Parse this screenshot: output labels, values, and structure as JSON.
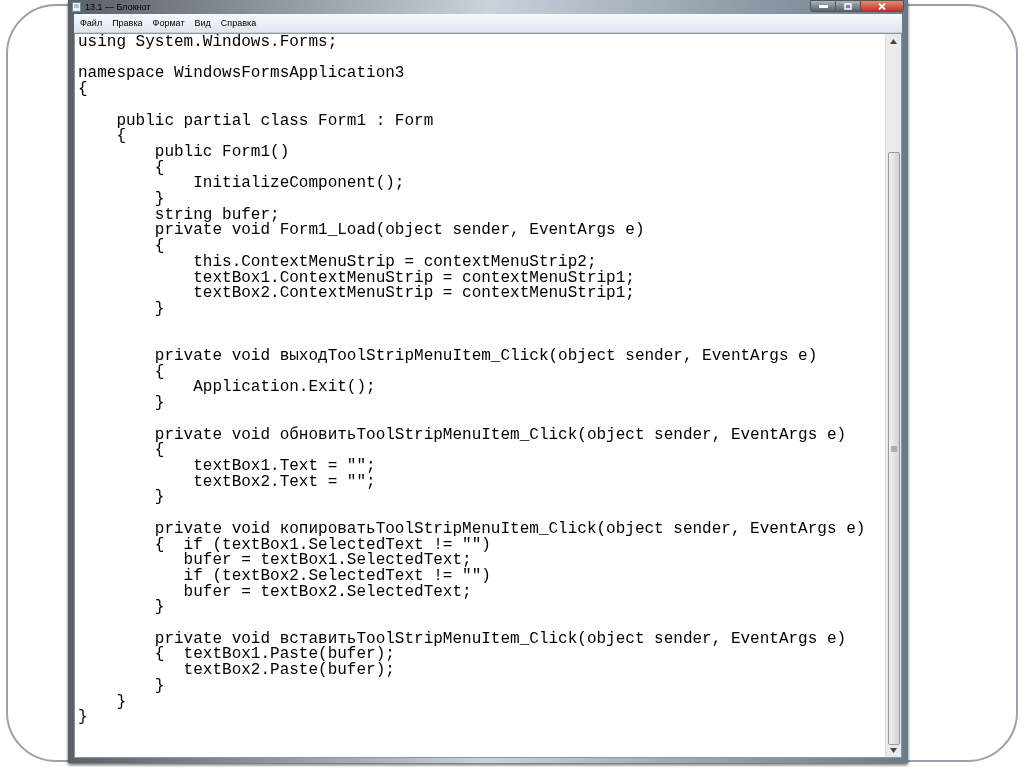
{
  "window": {
    "title": "13.1 — Блокнот"
  },
  "menu": [
    "Файл",
    "Правка",
    "Формат",
    "Вид",
    "Справка"
  ],
  "editor": {
    "text": "using System.Windows.Forms;\n\nnamespace WindowsFormsApplication3\n{\n\n    public partial class Form1 : Form\n    {\n        public Form1()\n        {\n            InitializeComponent();\n        }\n        string bufer;\n        private void Form1_Load(object sender, EventArgs e)\n        {\n            this.ContextMenuStrip = contextMenuStrip2;\n            textBox1.ContextMenuStrip = contextMenuStrip1;\n            textBox2.ContextMenuStrip = contextMenuStrip1;\n        }\n\n\n        private void выходToolStripMenuItem_Click(object sender, EventArgs e)\n        {\n            Application.Exit();\n        }\n\n        private void обновитьToolStripMenuItem_Click(object sender, EventArgs e)\n        {\n            textBox1.Text = \"\";\n            textBox2.Text = \"\";\n        }\n\n        private void копироватьToolStripMenuItem_Click(object sender, EventArgs e)\n        {  if (textBox1.SelectedText != \"\")\n           bufer = textBox1.SelectedText;\n           if (textBox2.SelectedText != \"\")\n           bufer = textBox2.SelectedText;\n        }\n\n        private void вставитьToolStripMenuItem_Click(object sender, EventArgs e)\n        {  textBox1.Paste(bufer);\n           textBox2.Paste(bufer);\n        }\n    }\n}"
  }
}
